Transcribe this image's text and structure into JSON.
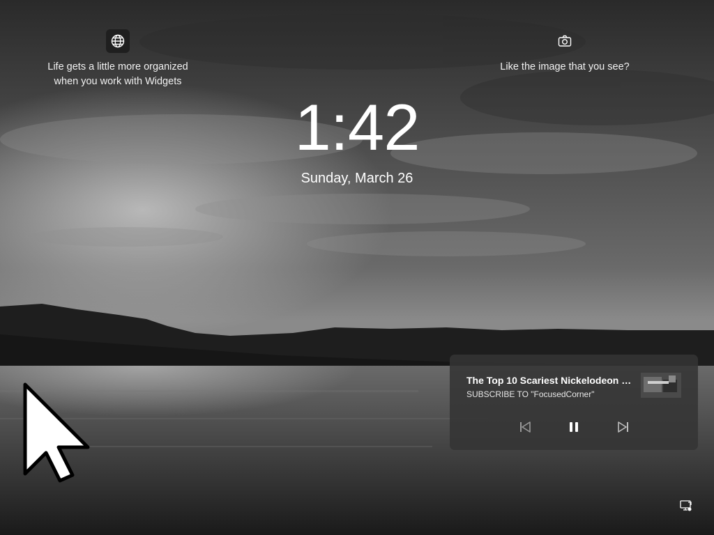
{
  "lockscreen": {
    "time": "1:42",
    "date": "Sunday, March 26"
  },
  "widgets_promo": {
    "icon": "globe-icon",
    "text": "Life gets a little more organized\nwhen you work with Widgets"
  },
  "spotlight_promo": {
    "icon": "camera-icon",
    "text": "Like the image that you see?"
  },
  "media": {
    "title": "The Top 10 Scariest Nickelodeon B...",
    "subtitle": "SUBSCRIBE TO \"FocusedCorner\"",
    "controls": [
      "previous-icon",
      "pause-icon",
      "next-icon"
    ]
  },
  "tray": {
    "icon": "network-icon"
  },
  "colors": {
    "text": "#ffffff",
    "card": "#343434"
  }
}
